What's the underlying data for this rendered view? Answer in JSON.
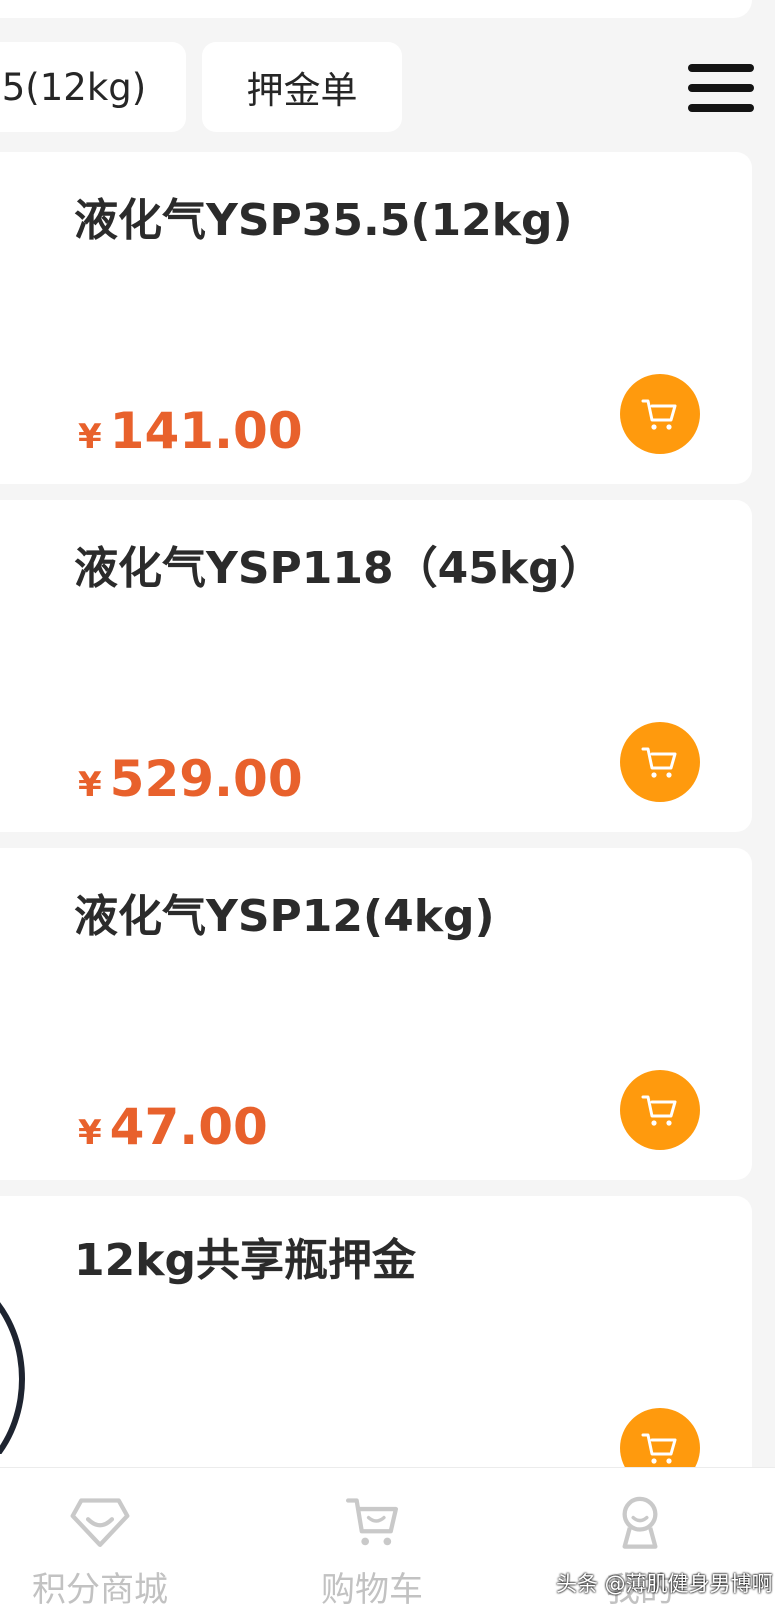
{
  "filter_chips": [
    {
      "label": ".5(12kg)"
    },
    {
      "label": "押金单"
    }
  ],
  "products": [
    {
      "title": "液化气YSP35.5(12kg)",
      "currency": "¥",
      "price": "141.00"
    },
    {
      "title": "液化气YSP118（45kg）",
      "currency": "¥",
      "price": "529.00"
    },
    {
      "title": "液化气YSP12(4kg)",
      "currency": "¥",
      "price": "47.00"
    },
    {
      "title": "12kg共享瓶押金"
    }
  ],
  "tabbar": {
    "items": [
      {
        "label": "积分商城",
        "icon": "diamond-icon"
      },
      {
        "label": "购物车",
        "icon": "cart-icon"
      },
      {
        "label": "我的",
        "icon": "user-icon"
      }
    ]
  },
  "watermark": "头条 @薄肌健身男博啊",
  "colors": {
    "price": "#e8612c",
    "cart_button": "#ff9a0d",
    "tab_inactive": "#c2c2c2",
    "background": "#f5f5f5"
  }
}
